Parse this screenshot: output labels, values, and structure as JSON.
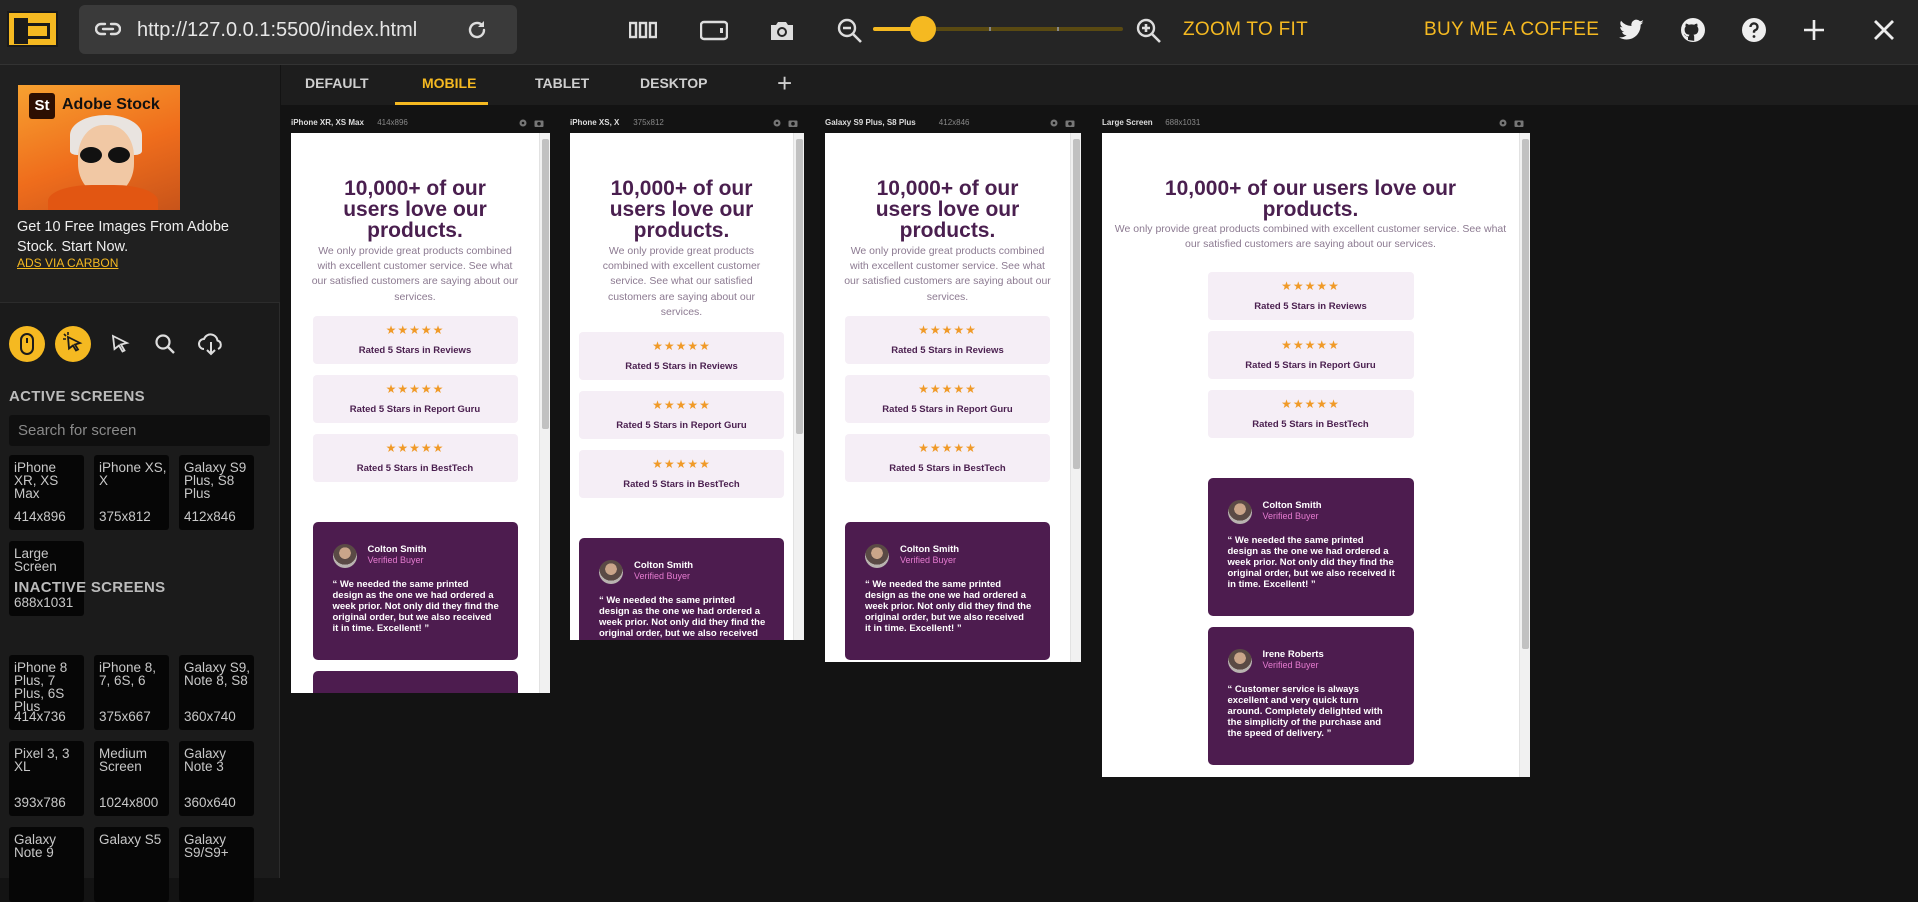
{
  "toolbar": {
    "url": "http://127.0.0.1:5500/index.html",
    "zoom_to_fit": "ZOOM TO FIT",
    "buy_coffee": "BUY ME A COFFEE",
    "zoom_level": 0.2,
    "accent": "#f5b921"
  },
  "ad": {
    "brand_badge": "St",
    "brand": "Adobe Stock",
    "text": "Get 10 Free Images From Adobe Stock. Start Now.",
    "link": "ADS VIA CARBON"
  },
  "sidebar": {
    "active_heading": "ACTIVE SCREENS",
    "search_placeholder": "Search for screen",
    "inactive_heading": "INACTIVE SCREENS",
    "active": [
      {
        "name": "iPhone XR, XS Max",
        "dims": "414x896"
      },
      {
        "name": "iPhone XS, X",
        "dims": "375x812"
      },
      {
        "name": "Galaxy S9 Plus, S8 Plus",
        "dims": "412x846"
      },
      {
        "name": "Large Screen",
        "dims": "688x1031"
      }
    ],
    "inactive": [
      {
        "name": "iPhone 8 Plus, 7 Plus, 6S Plus",
        "dims": "414x736"
      },
      {
        "name": "iPhone 8, 7, 6S, 6",
        "dims": "375x667"
      },
      {
        "name": "Galaxy S9, Note 8, S8",
        "dims": "360x740"
      },
      {
        "name": "Pixel 3, 3 XL",
        "dims": "393x786"
      },
      {
        "name": "Medium Screen",
        "dims": "1024x800"
      },
      {
        "name": "Galaxy Note 3",
        "dims": "360x640"
      },
      {
        "name": "Galaxy Note 9",
        "dims": ""
      },
      {
        "name": "Galaxy S5",
        "dims": ""
      },
      {
        "name": "Galaxy S9/S9+",
        "dims": ""
      }
    ]
  },
  "tabs": [
    "DEFAULT",
    "MOBILE",
    "TABLET",
    "DESKTOP"
  ],
  "tab_plus": "+",
  "devices": [
    {
      "label": "iPhone XR, XS Max",
      "dims": "414x896"
    },
    {
      "label": "iPhone XS, X",
      "dims": "375x812"
    },
    {
      "label": "Galaxy S9 Plus, S8 Plus",
      "dims": "412x846"
    },
    {
      "label": "Large Screen",
      "dims": "688x1031"
    }
  ],
  "site": {
    "heading": "10,000+ of our users love our products.",
    "intro": "We only provide great products combined with excellent customer service. See what our satisfied customers are saying about our services.",
    "stars": "★★★★★",
    "ratings": [
      "Rated 5 Stars in Reviews",
      "Rated 5 Stars in Report Guru",
      "Rated 5 Stars in BestTech"
    ],
    "reviews": [
      {
        "name": "Colton Smith",
        "badge": "Verified Buyer",
        "quote": "“ We needed the same printed design as the one we had ordered a week prior. Not only did they find the original order, but we also received it in time. Excellent! ”"
      },
      {
        "name": "Irene Roberts",
        "badge": "Verified Buyer",
        "quote": "“ Customer service is always excellent and very quick turn around. Completely delighted with the simplicity of the purchase and the speed of delivery. ”"
      }
    ]
  }
}
